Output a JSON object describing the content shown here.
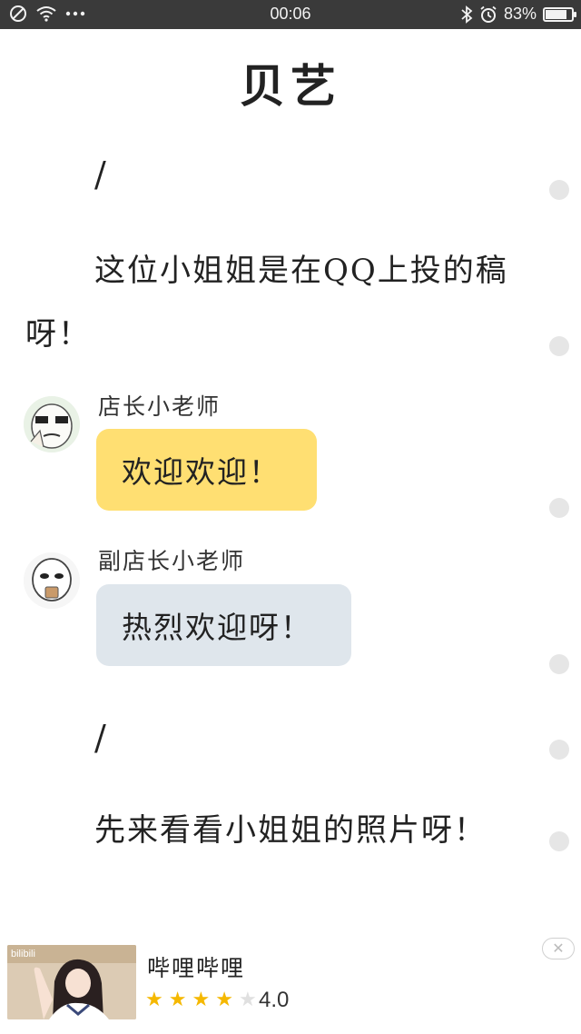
{
  "status_bar": {
    "time": "00:06",
    "battery": "83%",
    "battery_level": 0.83,
    "icons_left": [
      "blocked-icon",
      "wifi-icon",
      "more-icon"
    ],
    "icons_right": [
      "bluetooth-icon",
      "alarm-icon",
      "battery-icon"
    ]
  },
  "article": {
    "title": "贝艺",
    "separator1": "/",
    "line1": "这位小姐姐是在QQ上投的稿",
    "line2": "呀！",
    "chat": [
      {
        "speaker": "店长小老师",
        "message": "欢迎欢迎！",
        "bubble_color": "#ffdf72"
      },
      {
        "speaker": "副店长小老师",
        "message": "热烈欢迎呀！",
        "bubble_color": "#dfe6ec"
      }
    ],
    "separator2": "/",
    "line3": "先来看看小姐姐的照片呀！"
  },
  "ad": {
    "thumb_tag": "bilibili",
    "app_name": "哔哩哔哩",
    "rating": "4.0",
    "stars_filled": 4,
    "stars_total": 5,
    "star_color": "#f5b800",
    "close_symbol": "✕"
  }
}
